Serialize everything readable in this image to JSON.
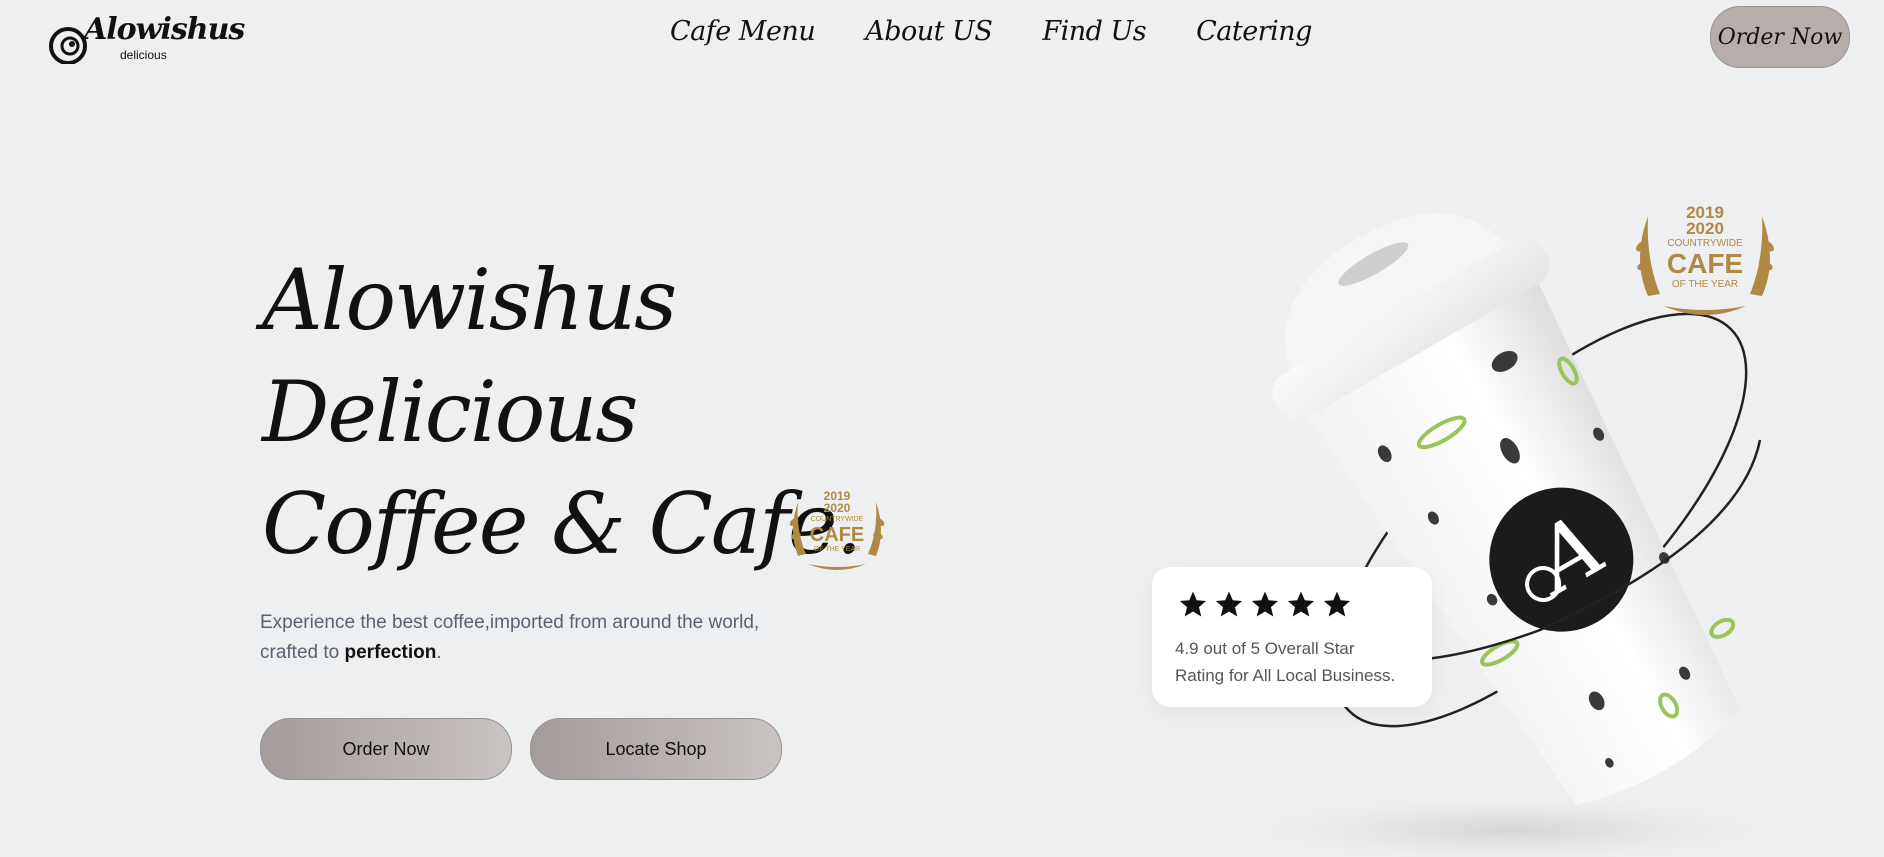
{
  "brand": {
    "name": "Alowishus",
    "sub": "delicious",
    "colors": {
      "gold": "#b08a44",
      "accent_button": "#b7aeac",
      "background": "#eeeff1",
      "leaf": "#9bc45a"
    }
  },
  "nav": {
    "items": [
      {
        "label": "Cafe Menu"
      },
      {
        "label": "About US"
      },
      {
        "label": "Find Us"
      },
      {
        "label": "Catering"
      }
    ],
    "order_button": "Order Now"
  },
  "hero": {
    "line1": "Alowishus",
    "line2": "Delicious",
    "line3": "Coffee & Cafe.",
    "tagline_part1": "Experience the best coffee,imported from around the world,",
    "tagline_part2": "crafted to ",
    "tagline_emphasis": "perfection",
    "tagline_end": ".",
    "buttons": {
      "order": "Order Now",
      "locate": "Locate Shop"
    }
  },
  "award": {
    "year1": "2019",
    "year2": "2020",
    "line1": "COUNTRYWIDE",
    "line2": "CAFE",
    "line3": "OF THE YEAR"
  },
  "rating": {
    "stars": 5,
    "text_line1": "4.9 out of 5 Overall Star",
    "text_line2": "Rating for All Local Business."
  },
  "cup_logo_letter": "A",
  "icons": {
    "logo": "coffee-bean-swirl-logo-icon",
    "star": "star-icon",
    "laurel": "laurel-wreath-icon"
  }
}
